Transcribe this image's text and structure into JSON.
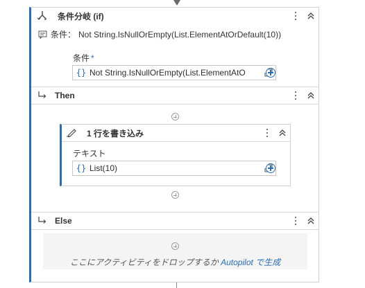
{
  "if_block": {
    "title": "条件分岐 (if)",
    "condition_summary_label": "条件：",
    "condition_summary_value": "Not String.IsNullOrEmpty(List.ElementAtOrDefault(10))",
    "condition_field_label": "条件",
    "required_mark": "*",
    "condition_expression": "Not String.IsNullOrEmpty(List.ElementAtO",
    "brace_glyph": "{}"
  },
  "then_section": {
    "label": "Then",
    "activity": {
      "title": "1 行を書き込み",
      "text_field_label": "テキスト",
      "text_expression": "List(10)",
      "brace_glyph": "{}"
    }
  },
  "else_section": {
    "label": "Else",
    "drop_hint_prefix": "ここにアクティビティをドロップするか",
    "drop_hint_link": "Autopilot",
    "drop_hint_suffix": "で生成"
  },
  "colors": {
    "accent": "#2b6cb0",
    "border": "#cfcfcf",
    "drop_zone_bg": "#f4f4f4"
  }
}
